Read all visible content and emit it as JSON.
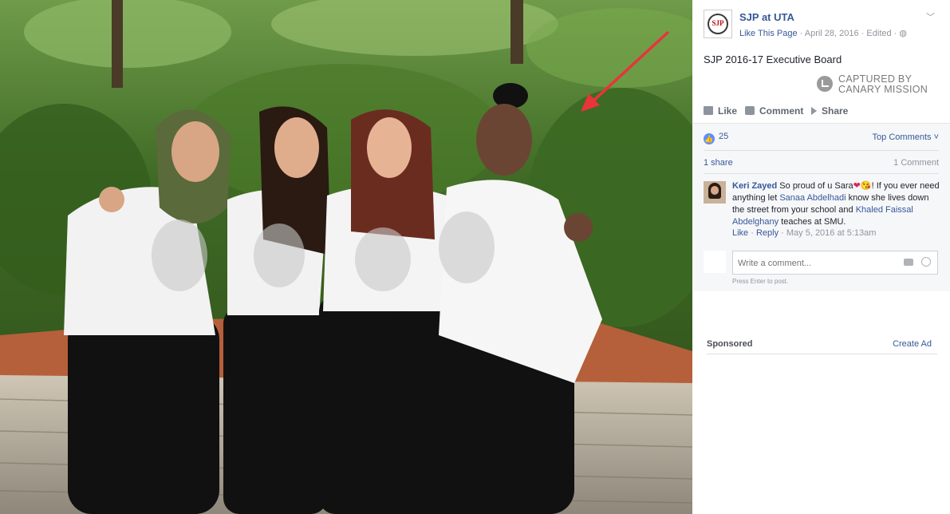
{
  "post": {
    "page_name": "SJP at UTA",
    "logo_text": "SJP",
    "like_page": "Like This Page",
    "dot1": " · ",
    "date": "April 28, 2016",
    "dot2": " · ",
    "edited": "Edited",
    "dot3": " · ",
    "text": "SJP 2016-17 Executive Board",
    "watermark_line1": "CAPTURED BY",
    "watermark_line2": "CANARY MISSION"
  },
  "actions": {
    "like": "Like",
    "comment": "Comment",
    "share": "Share"
  },
  "ufi": {
    "like_count": "25",
    "top_comments": "Top Comments ˅",
    "shares": "1 share",
    "comment_count": "1 Comment"
  },
  "comment": {
    "author": "Keri Zayed",
    "text_1": " So proud of u Sara",
    "heart": "❤",
    "text_2": "! If you ever need anything let ",
    "mention_1": "Sanaa Abdelhadi",
    "text_3": " know she lives down the street from your school and ",
    "mention_2": "Khaled Faissal Abdelghany",
    "text_4": " teaches at SMU.",
    "like": "Like",
    "reply": "Reply",
    "timestamp": "May 5, 2016 at 5:13am",
    "meta_sep": " · "
  },
  "composer": {
    "placeholder": "Write a comment...",
    "hint": "Press Enter to post."
  },
  "sidebar": {
    "sponsored": "Sponsored",
    "create_ad": "Create Ad"
  },
  "colors": {
    "link": "#365899",
    "arrow": "#e8343a",
    "like_badge": "#5890ff"
  }
}
